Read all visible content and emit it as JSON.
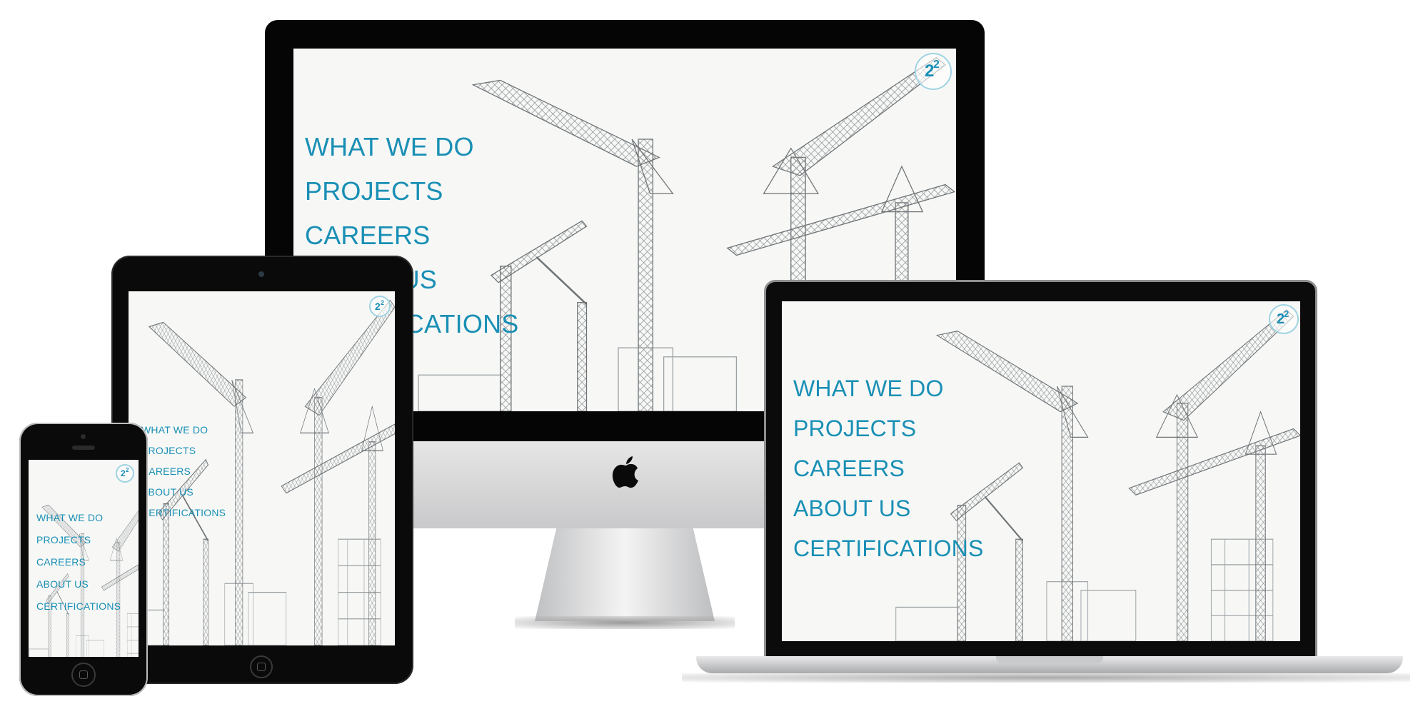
{
  "brand": {
    "accent": "#1a8fb5",
    "logo_icon": "company-logo-icon"
  },
  "menu": {
    "items": [
      "WHAT WE DO",
      "PROJECTS",
      "CAREERS",
      "ABOUT US",
      "CERTIFICATIONS"
    ]
  },
  "devices": {
    "desktop": {
      "name": "iMac",
      "icon": "apple-logo-icon"
    },
    "laptop": {
      "name": "MacBook"
    },
    "tablet": {
      "name": "iPad"
    },
    "phone": {
      "name": "iPhone"
    }
  }
}
